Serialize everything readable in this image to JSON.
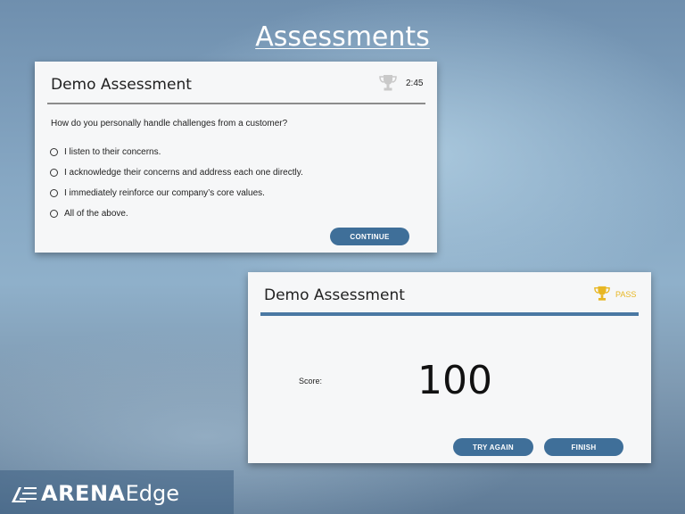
{
  "page": {
    "title": "Assessments"
  },
  "quiz": {
    "title": "Demo Assessment",
    "timer": "2:45",
    "question": "How do you personally handle challenges from a customer?",
    "options": [
      "I listen to their concerns.",
      "I acknowledge their concerns and address each one directly.",
      "I immediately reinforce our company’s core values.",
      "All of the above."
    ],
    "continue_label": "CONTINUE",
    "trophy_icon": "trophy-icon",
    "trophy_color": "#c9c9c9"
  },
  "result": {
    "title": "Demo Assessment",
    "status": "PASS",
    "status_color": "#e8b723",
    "score_label": "Score:",
    "score_value": "100",
    "try_again_label": "TRY AGAIN",
    "finish_label": "FINISH",
    "accent_color": "#4a78a3"
  },
  "brand": {
    "name_bold": "ARENA",
    "name_light": "Edge",
    "logo_icon": "arena-edge-logo"
  }
}
